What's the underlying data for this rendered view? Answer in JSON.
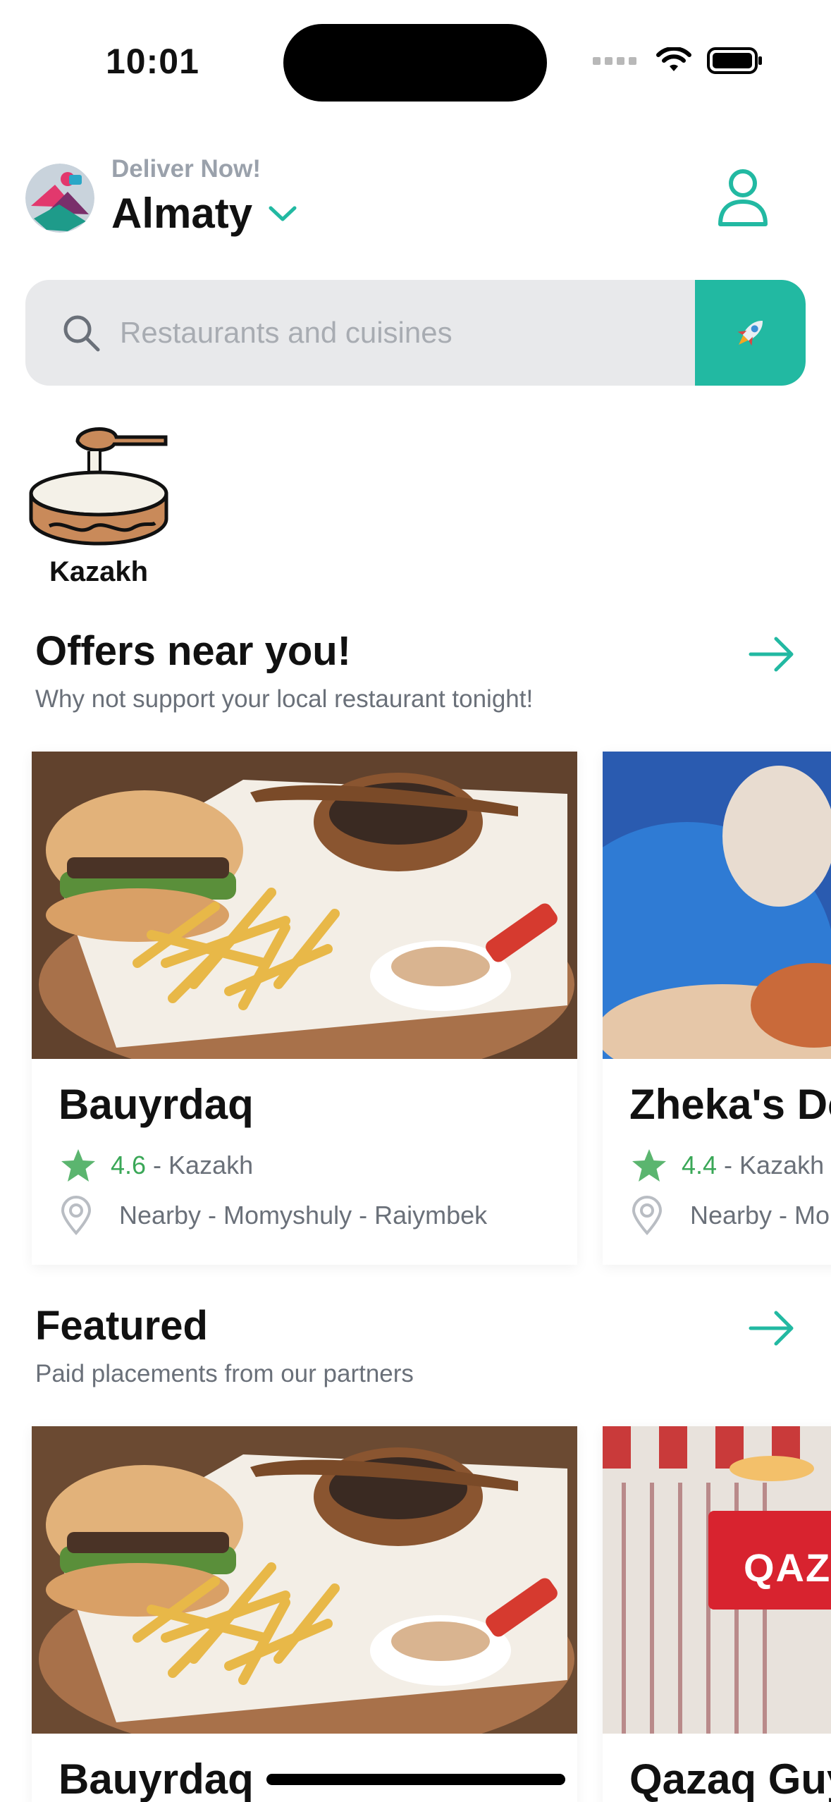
{
  "status_bar": {
    "time": "10:01"
  },
  "header": {
    "deliver_label": "Deliver Now!",
    "city": "Almaty",
    "accent_color": "#22b9a2"
  },
  "search": {
    "placeholder": "Restaurants and cuisines",
    "value": ""
  },
  "categories": [
    {
      "label": "Kazakh",
      "icon": "kazakh-bowl-icon"
    }
  ],
  "offers": {
    "title": "Offers near you!",
    "subtitle": "Why not support your local restaurant tonight!",
    "cards": [
      {
        "name": "Bauyrdaq",
        "rating": "4.6",
        "separator": " - ",
        "cuisine": "Kazakh",
        "location": "Nearby - Momyshuly - Raiymbek"
      },
      {
        "name": "Zheka's Doner",
        "rating": "4.4",
        "separator": " - ",
        "cuisine": "Kazakh",
        "location": "Nearby - Mo"
      }
    ]
  },
  "featured": {
    "title": "Featured",
    "subtitle": "Paid placements from our partners",
    "cards": [
      {
        "name": "Bauyrdaq"
      },
      {
        "name": "Qazaq Guys",
        "sign_text": "QAZ"
      }
    ]
  }
}
